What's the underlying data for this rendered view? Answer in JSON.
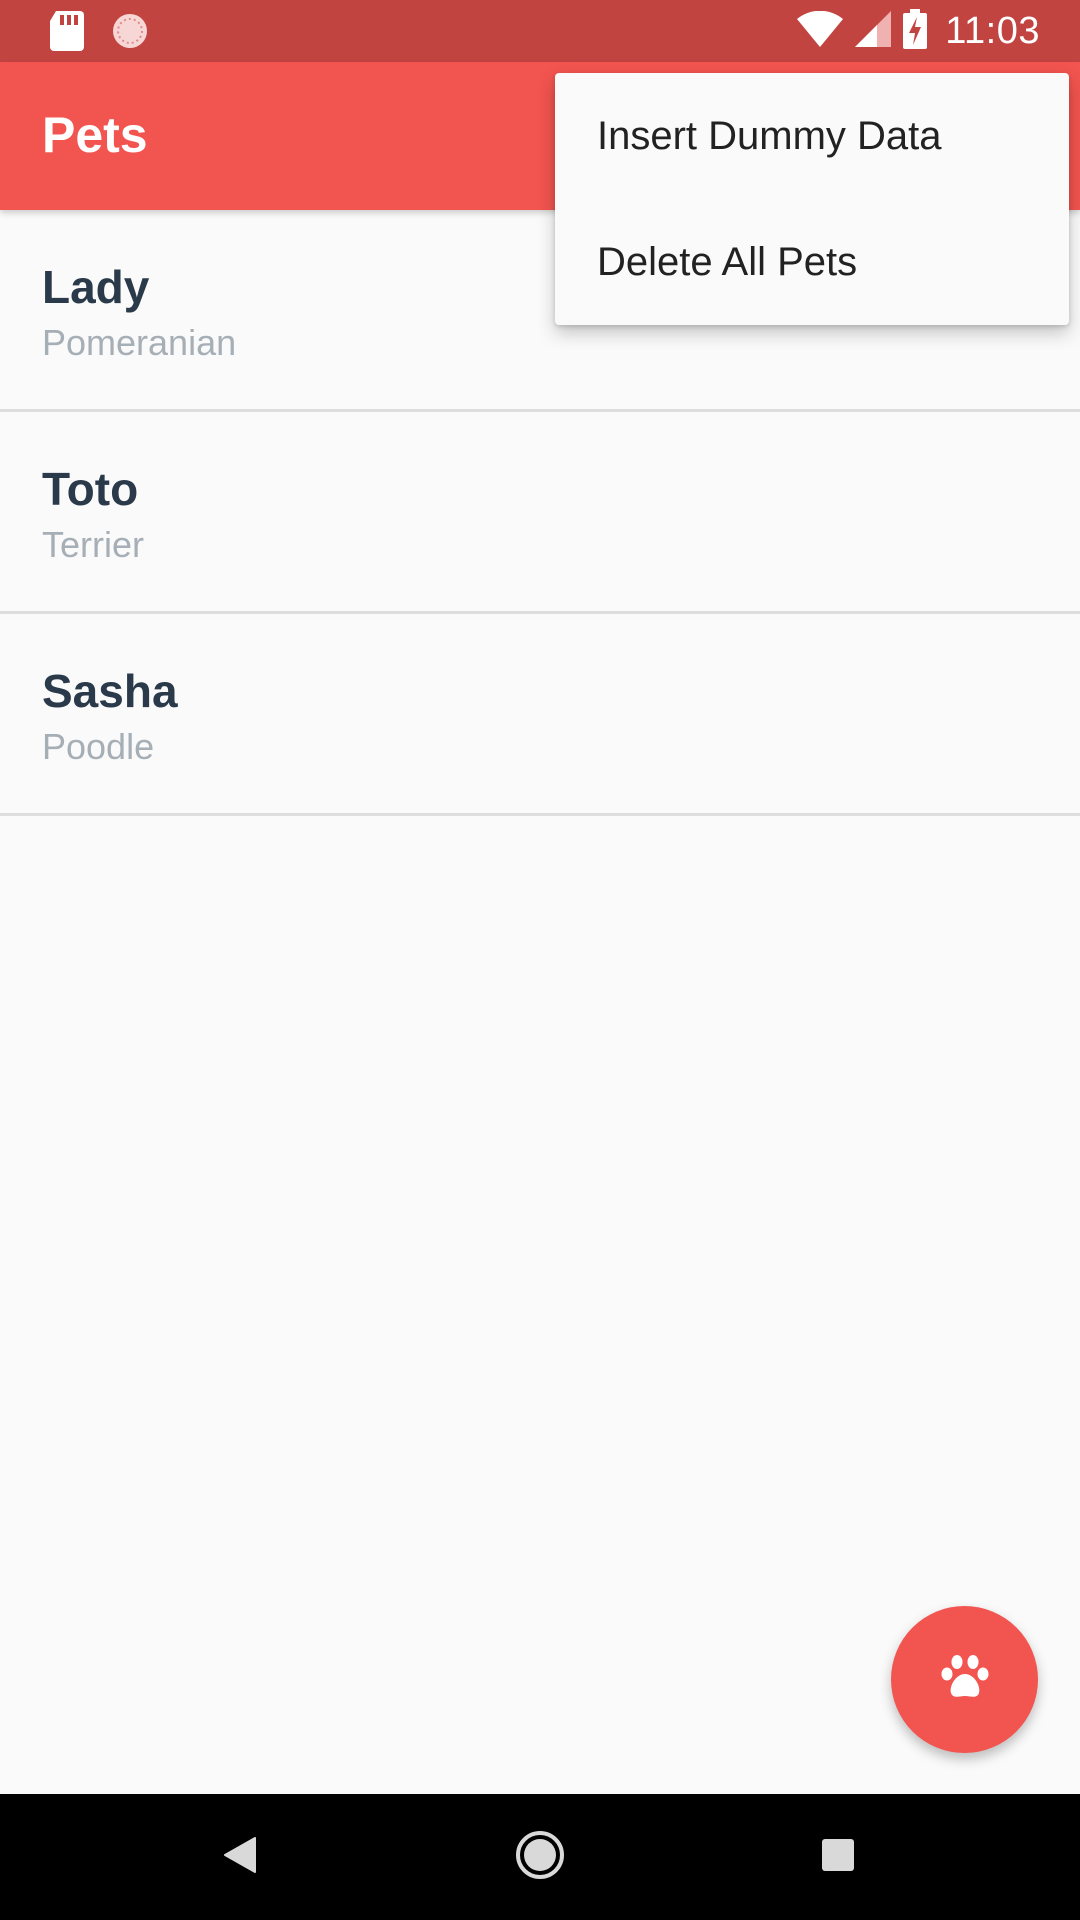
{
  "status_bar": {
    "time": "11:03",
    "icons": [
      "sd-card-icon",
      "sync-icon",
      "wifi-icon",
      "signal-icon",
      "battery-charging-icon"
    ]
  },
  "app_bar": {
    "title": "Pets"
  },
  "pets": [
    {
      "name": "Lady",
      "breed": "Pomeranian"
    },
    {
      "name": "Toto",
      "breed": "Terrier"
    },
    {
      "name": "Sasha",
      "breed": "Poodle"
    }
  ],
  "overflow_menu": {
    "items": [
      {
        "label": "Insert Dummy Data"
      },
      {
        "label": "Delete All Pets"
      }
    ]
  },
  "fab": {
    "icon": "paw-icon"
  },
  "nav_bar": {
    "icons": [
      "back-icon",
      "home-icon",
      "recents-icon"
    ]
  },
  "colors": {
    "primary": "#f2544f",
    "primary_dark": "#c24441",
    "name_text": "#2b3a4a",
    "breed_text": "#a6aeb6",
    "background": "#fafafa"
  }
}
